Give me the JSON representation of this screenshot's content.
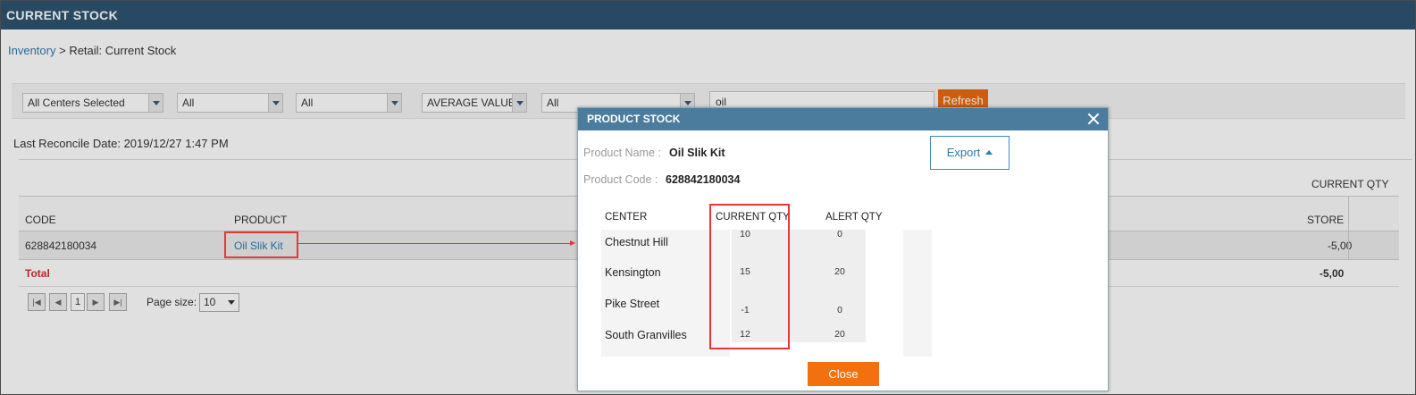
{
  "header": {
    "title": "CURRENT STOCK"
  },
  "breadcrumb": {
    "root": "Inventory",
    "separator": " > ",
    "current": "Retail: Current Stock"
  },
  "filters": {
    "center": "All Centers Selected",
    "f2": "All",
    "f3": "All",
    "value_type": "AVERAGE VALUE",
    "f5": "All",
    "search_value": "oil",
    "refresh_label": "Refresh"
  },
  "reconcile": {
    "text": "Last Reconcile Date: 2019/12/27 1:47 PM"
  },
  "grid": {
    "group_header": "CURRENT QTY",
    "columns": {
      "code": "CODE",
      "product": "PRODUCT",
      "store": "STORE"
    },
    "rows": [
      {
        "code": "628842180034",
        "product": "Oil Slik Kit",
        "store": "-5,00"
      }
    ],
    "total": {
      "label": "Total",
      "store": "-5,00"
    }
  },
  "pager": {
    "page": "1",
    "page_size_label": "Page size:",
    "page_size": "10"
  },
  "modal": {
    "title": "PRODUCT STOCK",
    "product_name_label": "Product Name :",
    "product_name": "Oil Slik Kit",
    "product_code_label": "Product Code :",
    "product_code": "628842180034",
    "export_label": "Export",
    "columns": {
      "center": "CENTER",
      "current_qty": "CURRENT QTY",
      "alert_qty": "ALERT QTY"
    },
    "rows": [
      {
        "center": "Chestnut Hill",
        "current": "10",
        "alert": "0"
      },
      {
        "center": "Kensington",
        "current": "15",
        "alert": "20"
      },
      {
        "center": "Pike Street",
        "current": "-1",
        "alert": "0"
      },
      {
        "center": "South Granvilles",
        "current": "12",
        "alert": "20"
      }
    ],
    "close_label": "Close"
  },
  "colors": {
    "header": "#2d5470",
    "modal_header": "#4b7c9e",
    "accent": "#f3700f",
    "highlight": "#e53935",
    "link": "#2a7ab0"
  }
}
